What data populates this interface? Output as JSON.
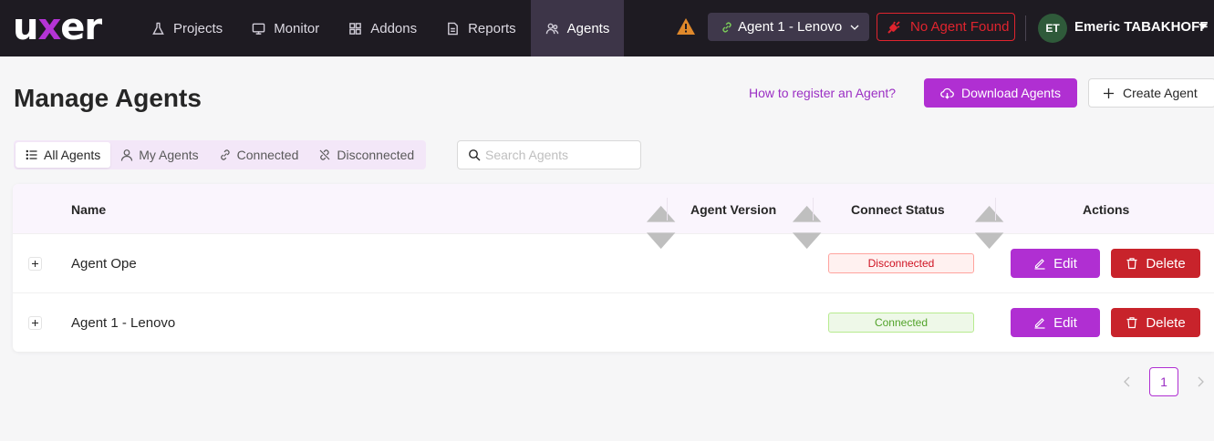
{
  "brand": {
    "logo_pre": "u",
    "logo_x": "x",
    "logo_post": "er"
  },
  "nav": [
    {
      "label": "Projects",
      "icon": "flask-icon"
    },
    {
      "label": "Monitor",
      "icon": "monitor-icon"
    },
    {
      "label": "Addons",
      "icon": "addons-icon"
    },
    {
      "label": "Reports",
      "icon": "report-icon"
    },
    {
      "label": "Agents",
      "icon": "agents-icon",
      "active": true
    }
  ],
  "topbar": {
    "selected_agent": "Agent 1 - Lenovo",
    "no_agent_label": "No Agent Found",
    "user_initials": "ET",
    "user_name": "Emeric TABAKHOFF"
  },
  "page": {
    "title": "Manage Agents",
    "how_link": "How to register an Agent?",
    "download_label": "Download Agents",
    "create_label": "Create Agent"
  },
  "filters": {
    "tabs": [
      "All Agents",
      "My Agents",
      "Connected",
      "Disconnected"
    ],
    "active": "All Agents",
    "search_placeholder": "Search Agents"
  },
  "table": {
    "columns": [
      "Name",
      "Agent Version",
      "Connect Status",
      "Actions"
    ],
    "rows": [
      {
        "name": "Agent Ope",
        "version": "",
        "status": "Disconnected"
      },
      {
        "name": "Agent 1 - Lenovo",
        "version": "",
        "status": "Connected"
      }
    ],
    "edit_label": "Edit",
    "delete_label": "Delete"
  },
  "pagination": {
    "current_page": "1"
  },
  "colors": {
    "accent": "#b02fd2",
    "danger": "#c8232b",
    "topbar": "#1e1b22",
    "warning": "#e0892b"
  }
}
